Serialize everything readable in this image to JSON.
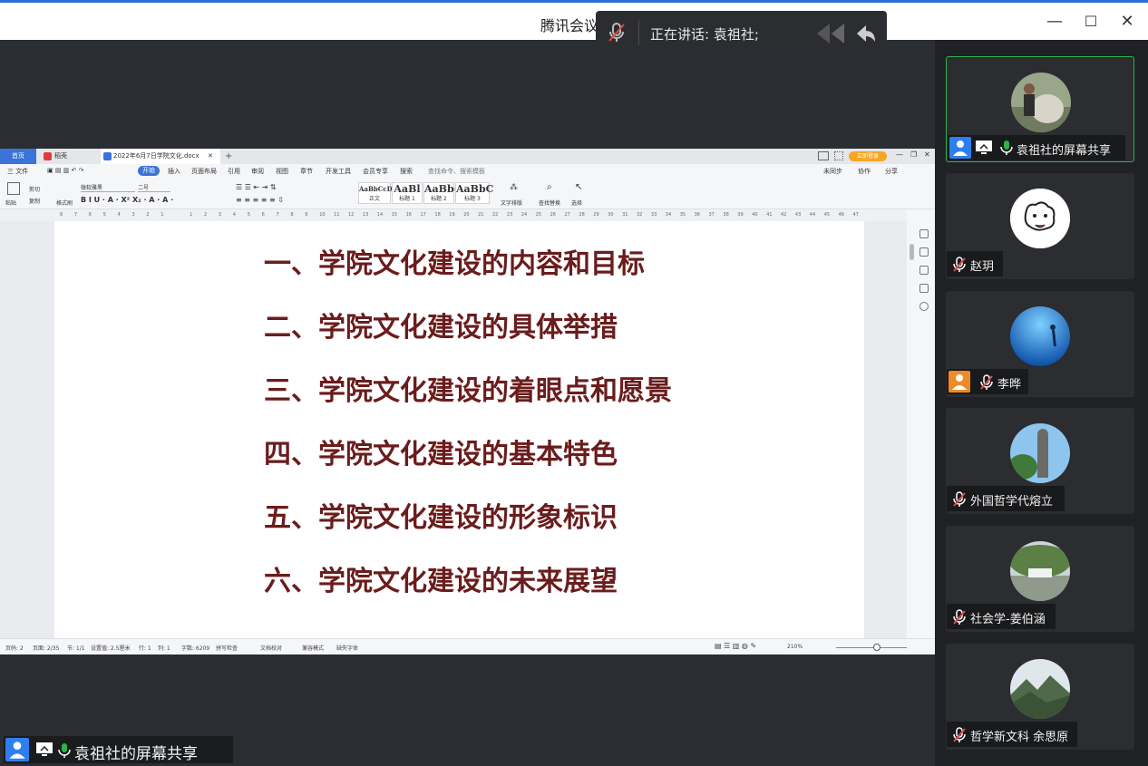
{
  "window": {
    "title": "腾讯会议",
    "minimize": "—",
    "maximize": "☐",
    "close": "✕"
  },
  "speaking": {
    "label": "正在讲话: 袁祖社;"
  },
  "doc": {
    "tabs": {
      "home": "首页",
      "wps": "稻壳",
      "file": "2022年6月7日学院文化.docx",
      "add": "+",
      "login": "立即登录"
    },
    "menu": [
      "三 文件",
      "开始",
      "插入",
      "页面布局",
      "引用",
      "审阅",
      "视图",
      "章节",
      "开发工具",
      "会员专享",
      "搜索"
    ],
    "menu_search": "查找命令、搜索模板",
    "menu_right": [
      "未同步",
      "协作",
      "分享"
    ],
    "ribbon": {
      "paste": "粘贴",
      "cut": "剪切",
      "copy": "复制",
      "format_painter": "格式刷",
      "font": "微软雅黑",
      "size": "二号",
      "styles": [
        {
          "sample": "AaBbCcDd",
          "name": "正文"
        },
        {
          "sample": "AaBl",
          "name": "标题 1"
        },
        {
          "sample": "AaBb(",
          "name": "标题 2"
        },
        {
          "sample": "AaBbC",
          "name": "标题 3"
        }
      ],
      "text_layout": "文字排版",
      "find_replace": "查找替换",
      "select": "选择"
    },
    "ruler_marks": [
      "8",
      "7",
      "6",
      "5",
      "4",
      "3",
      "2",
      "1",
      "",
      "1",
      "2",
      "3",
      "4",
      "5",
      "6",
      "7",
      "8",
      "9",
      "10",
      "11",
      "12",
      "13",
      "14",
      "15",
      "16",
      "17",
      "18",
      "19",
      "20",
      "21",
      "22",
      "23",
      "24",
      "25",
      "26",
      "27",
      "28",
      "29",
      "30",
      "31",
      "32",
      "33",
      "34",
      "35",
      "36",
      "37",
      "38",
      "39",
      "40",
      "41",
      "42",
      "43",
      "44",
      "45",
      "46",
      "47"
    ],
    "headings": [
      "一、学院文化建设的内容和目标",
      "二、学院文化建设的具体举措",
      "三、学院文化建设的着眼点和愿景",
      "四、学院文化建设的基本特色",
      "五、学院文化建设的形象标识",
      "六、学院文化建设的未来展望"
    ],
    "status": {
      "page_num": "页码: 2",
      "pages": "页面: 2/35",
      "section": "节: 1/1",
      "setting": "设置值: 2.5厘米",
      "row": "行: 1",
      "col": "列: 1",
      "words": "字数: 6209",
      "spell": "拼写检查",
      "proof": "文档校对",
      "compat": "兼容模式",
      "missing_font": "缺失字体",
      "zoom": "210%"
    }
  },
  "presenter": {
    "name": "袁祖社的屏幕共享"
  },
  "participants": [
    {
      "name": "袁祖社的屏幕共享",
      "mic": "on",
      "active": true
    },
    {
      "name": "赵玥",
      "mic": "muted",
      "active": false
    },
    {
      "name": "李晔",
      "mic": "muted",
      "active": false
    },
    {
      "name": "外国哲学代熔立",
      "mic": "muted",
      "active": false
    },
    {
      "name": "社会学-姜伯涵",
      "mic": "muted",
      "active": false
    },
    {
      "name": "哲学新文科 余思原",
      "mic": "muted",
      "active": false
    }
  ],
  "colors": {
    "heading": "#6b1c1c",
    "accent": "#2f6fd6",
    "active_border": "#2fb34a",
    "mic_on": "#2fb34a",
    "muted": "#e04a4a"
  }
}
